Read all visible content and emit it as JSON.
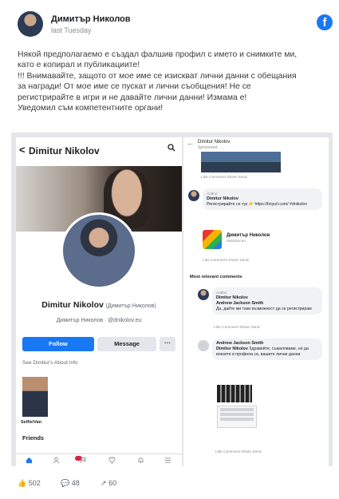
{
  "post": {
    "author": "Димитър Николов",
    "time": "last Tuesday",
    "lines": [
      "Някой предполагаемо е създал фалшив профил с името и снимките ми,",
      "като е копирал и публикациите!",
      "!!! Внимавайте, защото от мое име се изискват лични данни с обещания",
      "за награди! От мое име се пускат и лични съобщения! Не се",
      "регистрирайте в игри и не давайте лични данни! Измама е!",
      "Уведомил съм компетентните органи!"
    ],
    "fb_icon": "f"
  },
  "left_phone": {
    "back_icon": "<",
    "profile_name": "Dimitur Nikolov",
    "search_icon": "search-icon",
    "display_name": "Dimitur Nikolov",
    "display_alt": "(Димитър Николов)",
    "handle": "Димитър Николов · @dnikolov.eu",
    "follow_label": "Follow",
    "message_label": "Message",
    "more_label": "···",
    "about_link": "See Dimitur's About Info",
    "tile_label": "Selfie/Van",
    "friends_label": "Friends"
  },
  "right_phone": {
    "top_name": "Dimitur Nikolov",
    "top_sub": "Sponsored · ...",
    "actions": "Like   Comment   Share   Send",
    "comment1_tag": "Author",
    "comment1_name": "Dimitur Nikolov",
    "comment1_text": "Регистрирайте се тук 👉 https://tinyurl.com/ #dnikolov",
    "page_name": "Димитър Николов",
    "page_sub": "dnikolov.eu",
    "section_label": "Most relevant comments",
    "comment2_tag": "Author",
    "comment2_name": "Dimitur Nikolov",
    "comment2_author": "Andrew Jackson Smith",
    "comment2_text": "Да, дайте ми тази възможност да се регистрирам",
    "comment3_author": "Andrew Jackson Smith",
    "comment3_name": "Dimitur Nikolov",
    "comment3_text": "Здравейте, съжаляваме, но да влезете в профила си, вашите лични данни"
  },
  "footer": {
    "likes": "502",
    "comments": "48",
    "shares": "60"
  },
  "colors": {
    "facebook_blue": "#1877f2",
    "badge_red": "#e41e3f"
  }
}
